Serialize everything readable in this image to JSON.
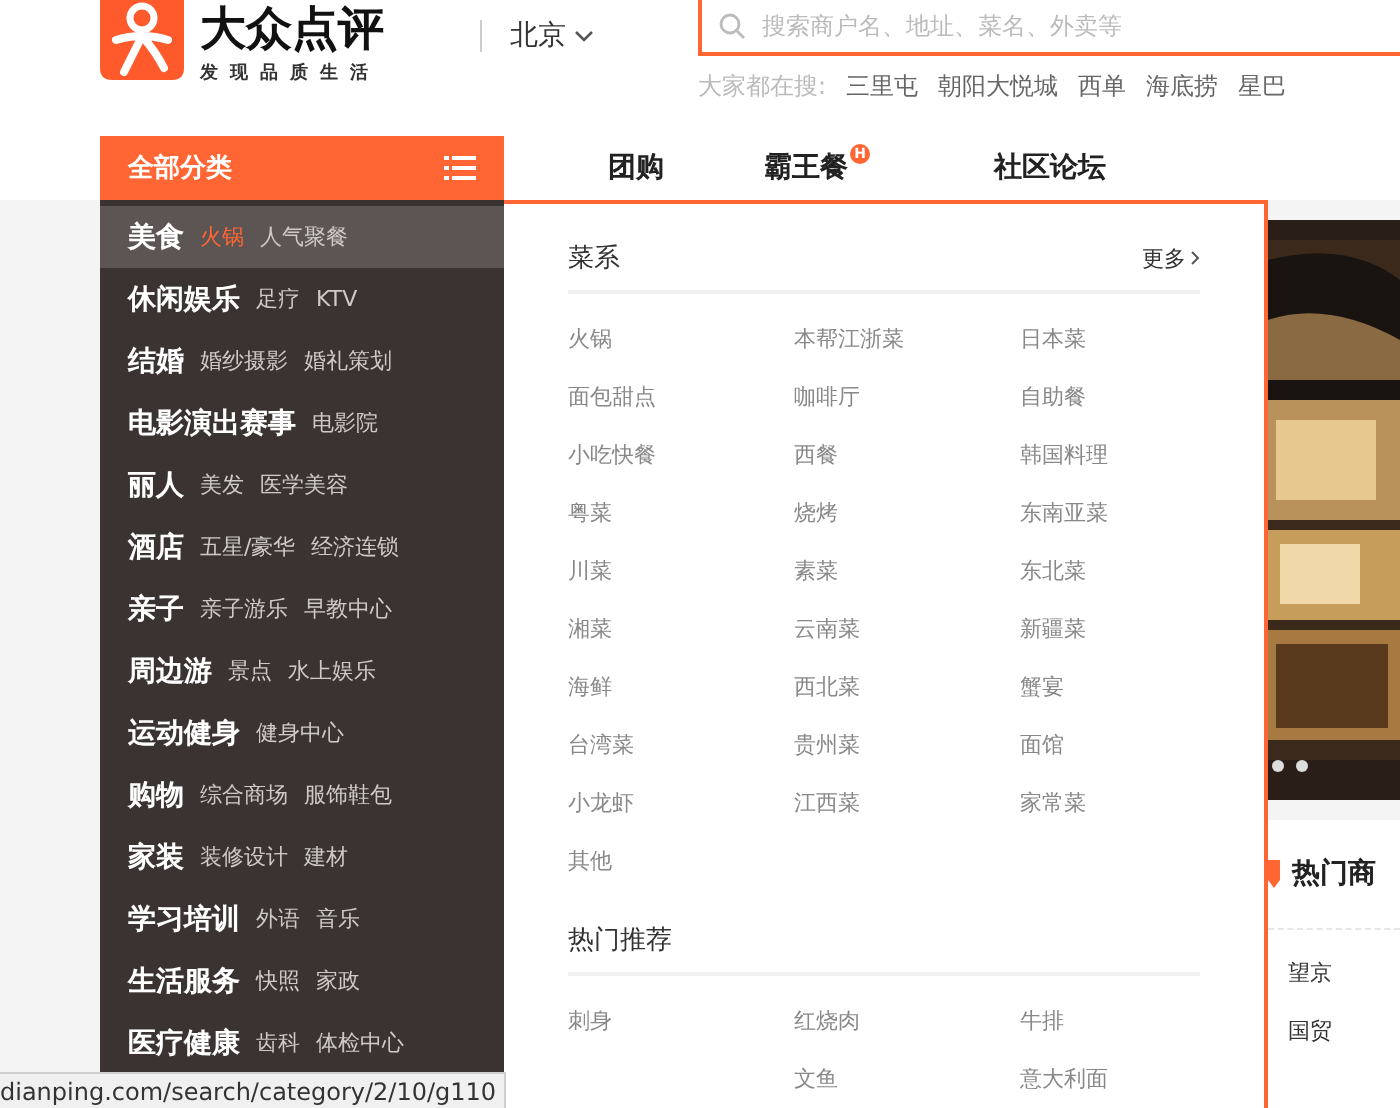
{
  "logo": {
    "name": "大众点评",
    "slogan": "发现品质生活"
  },
  "city": "北京",
  "search": {
    "placeholder": "搜索商户名、地址、菜名、外卖等"
  },
  "hot_searches": {
    "label": "大家都在搜:",
    "items": [
      "三里屯",
      "朝阳大悦城",
      "西单",
      "海底捞",
      "星巴"
    ]
  },
  "category_button": "全部分类",
  "nav": [
    {
      "label": "团购"
    },
    {
      "label": "霸王餐",
      "badge": "H"
    },
    {
      "label": "社区论坛"
    }
  ],
  "categories": [
    {
      "label": "美食",
      "selected": true,
      "links": [
        {
          "label": "火锅",
          "highlighted": true
        },
        {
          "label": "人气聚餐",
          "highlighted": false
        }
      ]
    },
    {
      "label": "休闲娱乐",
      "selected": false,
      "links": [
        {
          "label": "足疗",
          "highlighted": false
        },
        {
          "label": "KTV",
          "highlighted": false
        }
      ]
    },
    {
      "label": "结婚",
      "selected": false,
      "links": [
        {
          "label": "婚纱摄影",
          "highlighted": false
        },
        {
          "label": "婚礼策划",
          "highlighted": false
        }
      ]
    },
    {
      "label": "电影演出赛事",
      "selected": false,
      "links": [
        {
          "label": "电影院",
          "highlighted": false
        }
      ]
    },
    {
      "label": "丽人",
      "selected": false,
      "links": [
        {
          "label": "美发",
          "highlighted": false
        },
        {
          "label": "医学美容",
          "highlighted": false
        }
      ]
    },
    {
      "label": "酒店",
      "selected": false,
      "links": [
        {
          "label": "五星/豪华",
          "highlighted": false
        },
        {
          "label": "经济连锁",
          "highlighted": false
        }
      ]
    },
    {
      "label": "亲子",
      "selected": false,
      "links": [
        {
          "label": "亲子游乐",
          "highlighted": false
        },
        {
          "label": "早教中心",
          "highlighted": false
        }
      ]
    },
    {
      "label": "周边游",
      "selected": false,
      "links": [
        {
          "label": "景点",
          "highlighted": false
        },
        {
          "label": "水上娱乐",
          "highlighted": false
        }
      ]
    },
    {
      "label": "运动健身",
      "selected": false,
      "links": [
        {
          "label": "健身中心",
          "highlighted": false
        }
      ]
    },
    {
      "label": "购物",
      "selected": false,
      "links": [
        {
          "label": "综合商场",
          "highlighted": false
        },
        {
          "label": "服饰鞋包",
          "highlighted": false
        }
      ]
    },
    {
      "label": "家装",
      "selected": false,
      "links": [
        {
          "label": "装修设计",
          "highlighted": false
        },
        {
          "label": "建材",
          "highlighted": false
        }
      ]
    },
    {
      "label": "学习培训",
      "selected": false,
      "links": [
        {
          "label": "外语",
          "highlighted": false
        },
        {
          "label": "音乐",
          "highlighted": false
        }
      ]
    },
    {
      "label": "生活服务",
      "selected": false,
      "links": [
        {
          "label": "快照",
          "highlighted": false
        },
        {
          "label": "家政",
          "highlighted": false
        }
      ]
    },
    {
      "label": "医疗健康",
      "selected": false,
      "links": [
        {
          "label": "齿科",
          "highlighted": false
        },
        {
          "label": "体检中心",
          "highlighted": false
        }
      ]
    }
  ],
  "panel_sections": [
    {
      "title": "菜系",
      "more": "更多",
      "items": [
        "火锅",
        "本帮江浙菜",
        "日本菜",
        "面包甜点",
        "咖啡厅",
        "自助餐",
        "小吃快餐",
        "西餐",
        "韩国料理",
        "粤菜",
        "烧烤",
        "东南亚菜",
        "川菜",
        "素菜",
        "东北菜",
        "湘菜",
        "云南菜",
        "新疆菜",
        "海鲜",
        "西北菜",
        "蟹宴",
        "台湾菜",
        "贵州菜",
        "面馆",
        "小龙虾",
        "江西菜",
        "家常菜",
        "其他"
      ]
    },
    {
      "title": "热门推荐",
      "items": [
        {
          "kind": "link",
          "label": "刺身"
        },
        {
          "kind": "link",
          "label": "红烧肉"
        },
        {
          "kind": "link",
          "label": "牛排"
        },
        {
          "kind": "covered"
        },
        {
          "kind": "link",
          "label": "文鱼"
        },
        {
          "kind": "link",
          "label": "意大利面"
        }
      ]
    }
  ],
  "side": {
    "heading": "热门商",
    "areas": [
      "望京",
      "国贸"
    ]
  },
  "status_url": "dianping.com/search/category/2/10/g110"
}
